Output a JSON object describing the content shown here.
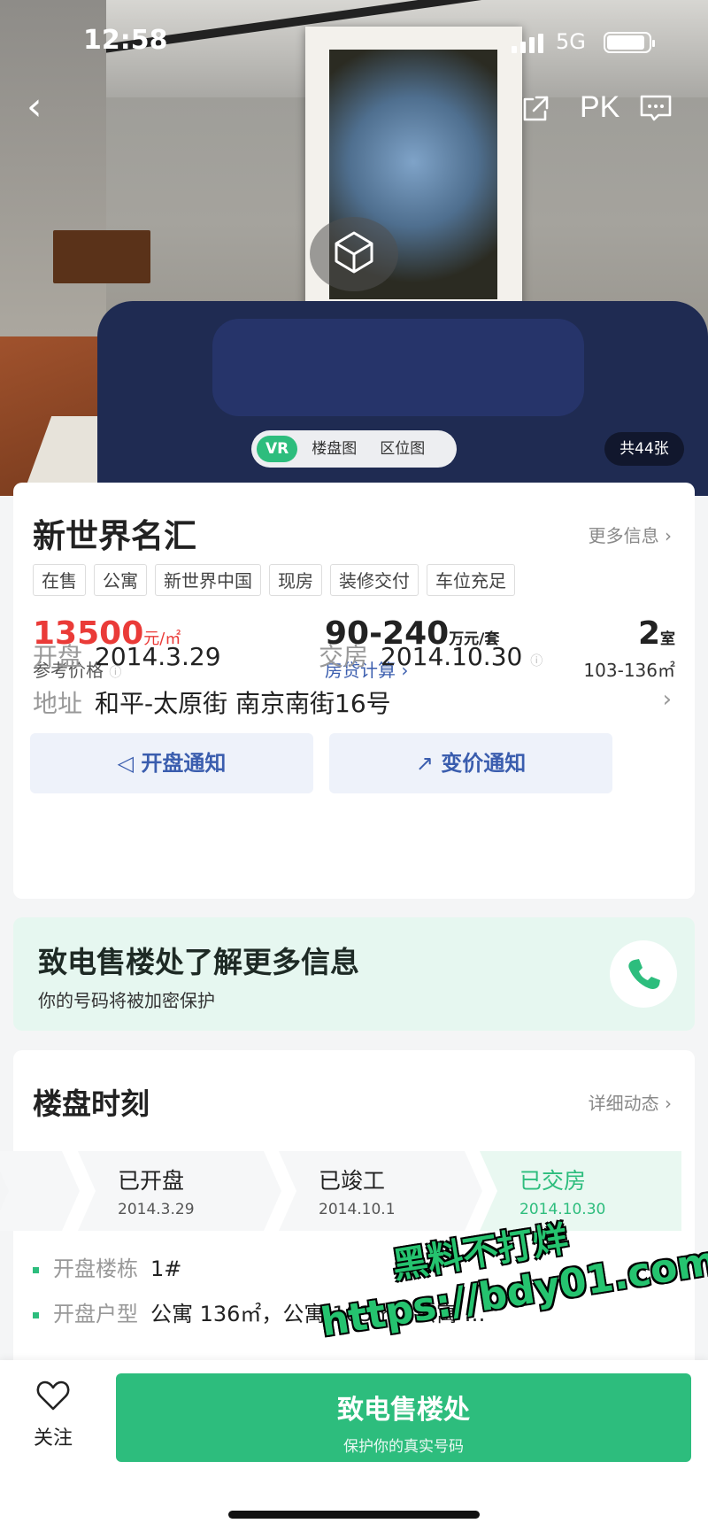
{
  "status_bar": {
    "time": "12:58",
    "network": "5G"
  },
  "nav": {
    "pk_label": "PK"
  },
  "media": {
    "tabs": [
      "VR",
      "楼盘图",
      "区位图"
    ],
    "photo_count": "共44张"
  },
  "project": {
    "name": "新世界名汇",
    "more_info": "更多信息",
    "tags": [
      "在售",
      "公寓",
      "新世界中国",
      "现房",
      "装修交付",
      "车位充足"
    ],
    "unit_price": "13500",
    "unit_price_unit": "元/㎡",
    "unit_price_label": "参考价格",
    "total_price": "90-240",
    "total_price_unit": "万元/套",
    "loan_link": "房贷计算",
    "rooms": "2",
    "rooms_unit": "室",
    "area": "103-136㎡",
    "open_label": "开盘",
    "open_date": "2014.3.29",
    "delivery_label": "交房",
    "delivery_date": "2014.10.30",
    "address_label": "地址",
    "address": "和平-太原街 南京南街16号",
    "open_notify": "开盘通知",
    "price_notify": "变价通知"
  },
  "call_banner": {
    "heading": "致电售楼处了解更多信息",
    "sub": "你的号码将被加密保护"
  },
  "timeline": {
    "title": "楼盘时刻",
    "more": "详细动态",
    "steps": [
      {
        "name": "已开盘",
        "date": "2014.3.29"
      },
      {
        "name": "已竣工",
        "date": "2014.10.1"
      },
      {
        "name": "已交房",
        "date": "2014.10.30"
      }
    ],
    "buildings_label": "开盘楼栋",
    "buildings_value": "1#",
    "types_label": "开盘户型",
    "types_value": "公寓 136㎡，公寓 103㎡，公寓 …"
  },
  "watermark": {
    "line1": "黑料不打烊",
    "line2": "https://bdy01.com"
  },
  "bottom_bar": {
    "follow_label": "关注",
    "cta_main": "致电售楼处",
    "cta_sub": "保护你的真实号码"
  },
  "colors": {
    "accent": "#2dbd7d",
    "price_red": "#ea3b38",
    "link_blue": "#3a5dae"
  }
}
